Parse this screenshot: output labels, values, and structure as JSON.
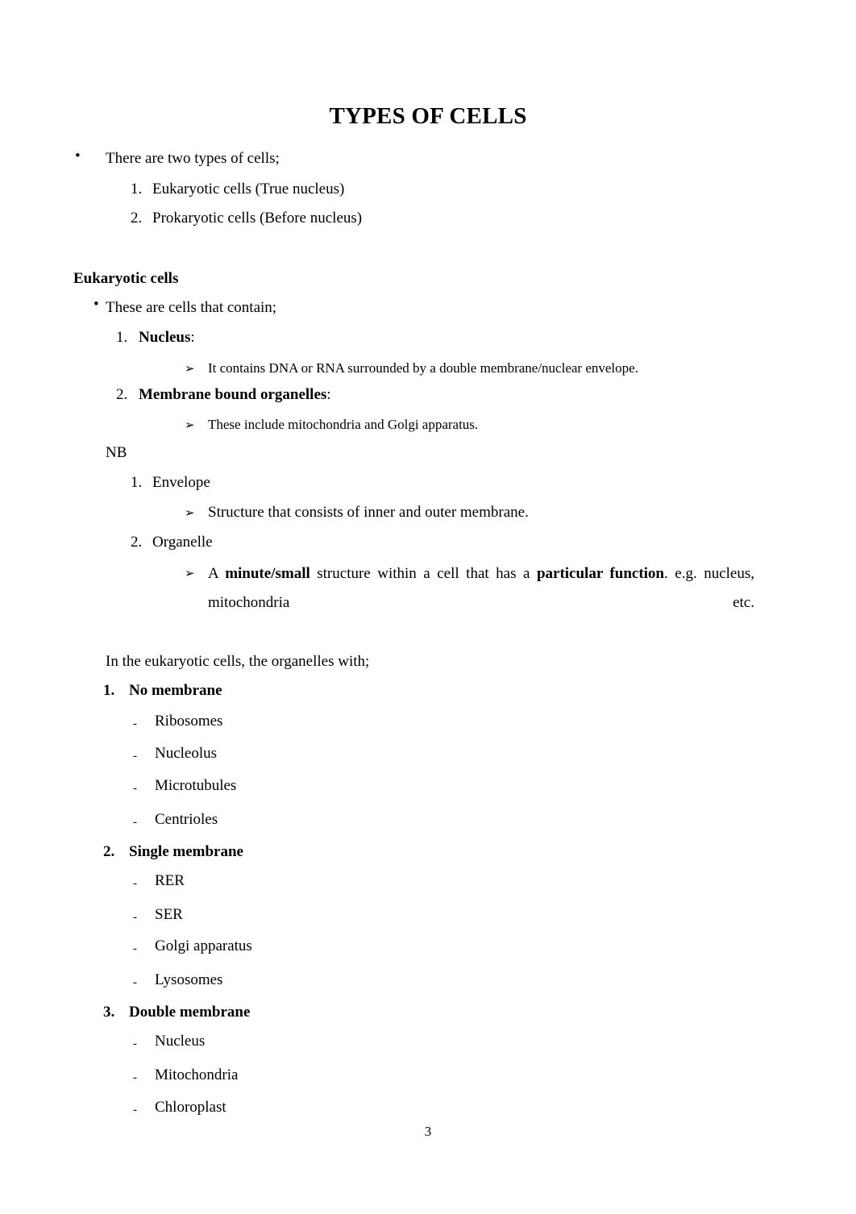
{
  "document": {
    "title": "TYPES OF CELLS",
    "page_number": "3"
  },
  "intro": {
    "bullet_marker": "•",
    "lead": "There are two types of cells;",
    "items": [
      {
        "number": "1.",
        "text": "Eukaryotic cells (True nucleus)"
      },
      {
        "number": "2.",
        "text": "Prokaryotic cells (Before nucleus)"
      }
    ]
  },
  "eukaryotic": {
    "heading": "Eukaryotic cells",
    "bullet_marker": "•",
    "lead": "These are cells that contain;",
    "arrow_marker": "➢",
    "items": [
      {
        "number": "1.",
        "label": "Nucleus",
        "label_suffix": ":",
        "detail": "It contains DNA or RNA surrounded by a double membrane/nuclear envelope."
      },
      {
        "number": "2.",
        "label": "Membrane bound organelles",
        "label_suffix": ":",
        "detail": "These include mitochondria and Golgi apparatus."
      }
    ]
  },
  "nb": {
    "label": "NB",
    "arrow_marker": "➢",
    "items": [
      {
        "number": "1.",
        "term": "Envelope",
        "definition": "Structure that consists of inner and outer membrane."
      },
      {
        "number": "2.",
        "term": "Organelle",
        "definition_parts": {
          "p1": "A ",
          "b1": "minute/small",
          "p2": " structure within a cell that has a ",
          "b2": "particular function",
          "p3": ". e.g. nucleus, mitochondria etc."
        }
      }
    ]
  },
  "organelle_groups": {
    "lead": "In the eukaryotic cells, the organelles with;",
    "dash_marker": "-",
    "groups": [
      {
        "number": "1.",
        "heading": "No membrane",
        "items": [
          "Ribosomes",
          "Nucleolus",
          "Microtubules",
          "Centrioles"
        ]
      },
      {
        "number": "2.",
        "heading": "Single membrane",
        "items": [
          "RER",
          "SER",
          "Golgi apparatus",
          "Lysosomes"
        ]
      },
      {
        "number": "3.",
        "heading": "Double membrane",
        "items": [
          "Nucleus",
          "Mitochondria",
          "Chloroplast"
        ]
      }
    ]
  }
}
